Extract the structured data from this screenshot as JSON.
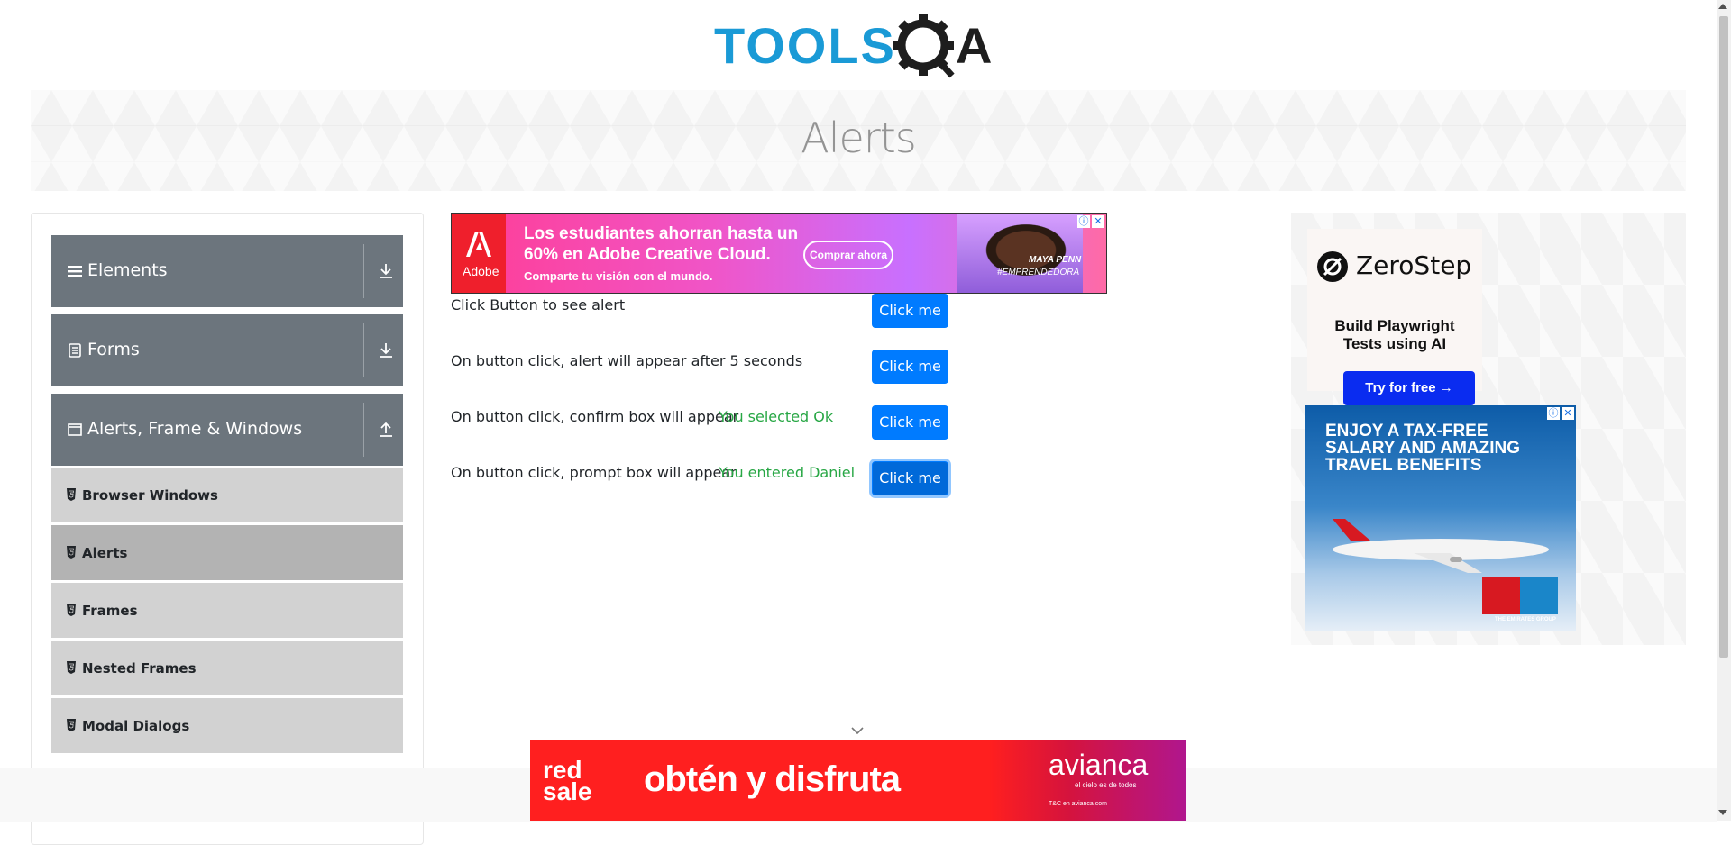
{
  "logo": {
    "text_left": "TOOLS",
    "text_right": "A"
  },
  "banner": {
    "title": "Alerts"
  },
  "sidebar": {
    "groups": [
      {
        "label": "Elements",
        "icon": "menu-icon",
        "state": "collapsed"
      },
      {
        "label": "Forms",
        "icon": "form-icon",
        "state": "collapsed"
      },
      {
        "label": "Alerts, Frame & Windows",
        "icon": "window-icon",
        "state": "expanded"
      }
    ],
    "items": [
      {
        "label": "Browser Windows",
        "active": false
      },
      {
        "label": "Alerts",
        "active": true
      },
      {
        "label": "Frames",
        "active": false
      },
      {
        "label": "Nested Frames",
        "active": false
      },
      {
        "label": "Modal Dialogs",
        "active": false
      }
    ]
  },
  "ad_top": {
    "brand": "Adobe",
    "line1": "Los estudiantes ahorran hasta un",
    "line2": "60% en Adobe Creative Cloud.",
    "line3": "Comparte tu visión con el mundo.",
    "cta": "Comprar ahora",
    "caption": "MAYA PENN",
    "caption2": "#EMPRENDEDORA"
  },
  "alerts": [
    {
      "label": "Click Button to see alert",
      "result": "",
      "button": "Click me"
    },
    {
      "label": "On button click, alert will appear after 5 seconds",
      "result": "",
      "button": "Click me"
    },
    {
      "label": "On button click, confirm box will appear",
      "result": "You selected Ok",
      "button": "Click me"
    },
    {
      "label": "On button click, prompt box will appear",
      "result": "You entered Daniel",
      "button": "Click me"
    }
  ],
  "ad_right": {
    "zerostep": {
      "name": "ZeroStep",
      "tag1": "Build Playwright",
      "tag2": "Tests using AI",
      "cta": "Try for free →"
    },
    "emirates": {
      "line1": "ENJOY A TAX-FREE",
      "line2": "SALARY AND AMAZING",
      "line3": "TRAVEL BENEFITS",
      "group": "THE EMIRATES GROUP"
    }
  },
  "ad_bottom": {
    "red_line1": "red",
    "red_line2": "sale",
    "headline": "obtén y disfruta",
    "brand": "avianca",
    "brand_sub": "el cielo es de todos",
    "terms": "T&C en avianca.com"
  },
  "colors": {
    "accent": "#007bff",
    "success": "#28a745",
    "sidebar_group": "#6c757d",
    "sidebar_item": "#d2d2d2"
  }
}
